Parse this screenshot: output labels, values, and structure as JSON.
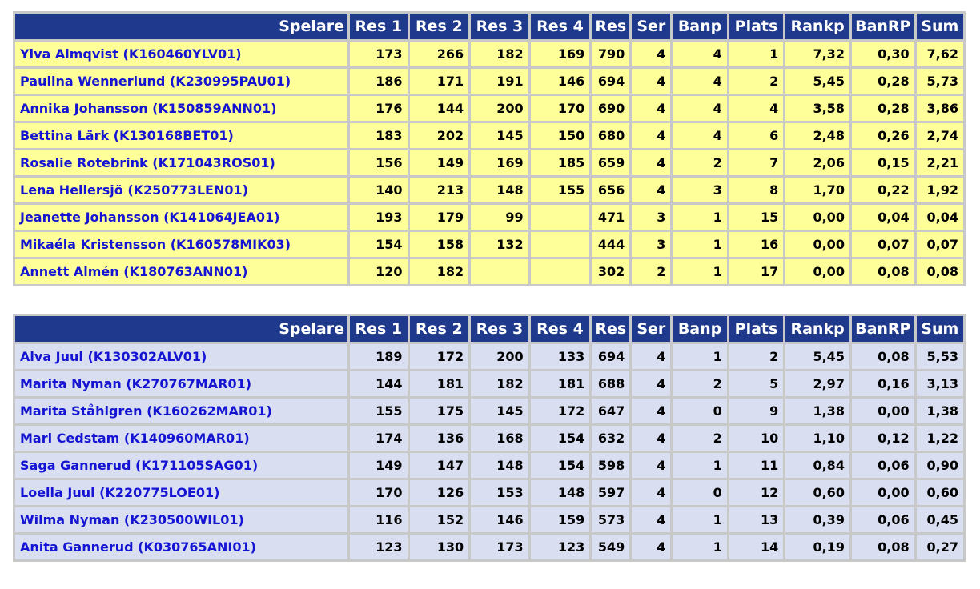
{
  "columns": [
    "Spelare",
    "Res 1",
    "Res 2",
    "Res 3",
    "Res 4",
    "Res",
    "Ser",
    "Banp",
    "Plats",
    "Rankp",
    "BanRP",
    "Sum"
  ],
  "tables": [
    {
      "rows": [
        {
          "name": "Ylva Almqvist (K160460YLV01)",
          "r1": "173",
          "r2": "266",
          "r3": "182",
          "r4": "169",
          "res": "790",
          "ser": "4",
          "banp": "4",
          "plats": "1",
          "rankp": "7,32",
          "banrp": "0,30",
          "sum": "7,62"
        },
        {
          "name": "Paulina Wennerlund (K230995PAU01)",
          "r1": "186",
          "r2": "171",
          "r3": "191",
          "r4": "146",
          "res": "694",
          "ser": "4",
          "banp": "4",
          "plats": "2",
          "rankp": "5,45",
          "banrp": "0,28",
          "sum": "5,73"
        },
        {
          "name": "Annika Johansson (K150859ANN01)",
          "r1": "176",
          "r2": "144",
          "r3": "200",
          "r4": "170",
          "res": "690",
          "ser": "4",
          "banp": "4",
          "plats": "4",
          "rankp": "3,58",
          "banrp": "0,28",
          "sum": "3,86"
        },
        {
          "name": "Bettina Lärk (K130168BET01)",
          "r1": "183",
          "r2": "202",
          "r3": "145",
          "r4": "150",
          "res": "680",
          "ser": "4",
          "banp": "4",
          "plats": "6",
          "rankp": "2,48",
          "banrp": "0,26",
          "sum": "2,74"
        },
        {
          "name": "Rosalie Rotebrink (K171043ROS01)",
          "r1": "156",
          "r2": "149",
          "r3": "169",
          "r4": "185",
          "res": "659",
          "ser": "4",
          "banp": "2",
          "plats": "7",
          "rankp": "2,06",
          "banrp": "0,15",
          "sum": "2,21"
        },
        {
          "name": "Lena Hellersjö (K250773LEN01)",
          "r1": "140",
          "r2": "213",
          "r3": "148",
          "r4": "155",
          "res": "656",
          "ser": "4",
          "banp": "3",
          "plats": "8",
          "rankp": "1,70",
          "banrp": "0,22",
          "sum": "1,92"
        },
        {
          "name": "Jeanette Johansson (K141064JEA01)",
          "r1": "193",
          "r2": "179",
          "r3": "99",
          "r4": "",
          "res": "471",
          "ser": "3",
          "banp": "1",
          "plats": "15",
          "rankp": "0,00",
          "banrp": "0,04",
          "sum": "0,04"
        },
        {
          "name": "Mikaéla Kristensson (K160578MIK03)",
          "r1": "154",
          "r2": "158",
          "r3": "132",
          "r4": "",
          "res": "444",
          "ser": "3",
          "banp": "1",
          "plats": "16",
          "rankp": "0,00",
          "banrp": "0,07",
          "sum": "0,07"
        },
        {
          "name": "Annett Almén (K180763ANN01)",
          "r1": "120",
          "r2": "182",
          "r3": "",
          "r4": "",
          "res": "302",
          "ser": "2",
          "banp": "1",
          "plats": "17",
          "rankp": "0,00",
          "banrp": "0,08",
          "sum": "0,08"
        }
      ]
    },
    {
      "rows": [
        {
          "name": "Alva Juul (K130302ALV01)",
          "r1": "189",
          "r2": "172",
          "r3": "200",
          "r4": "133",
          "res": "694",
          "ser": "4",
          "banp": "1",
          "plats": "2",
          "rankp": "5,45",
          "banrp": "0,08",
          "sum": "5,53"
        },
        {
          "name": "Marita Nyman (K270767MAR01)",
          "r1": "144",
          "r2": "181",
          "r3": "182",
          "r4": "181",
          "res": "688",
          "ser": "4",
          "banp": "2",
          "plats": "5",
          "rankp": "2,97",
          "banrp": "0,16",
          "sum": "3,13"
        },
        {
          "name": "Marita Ståhlgren (K160262MAR01)",
          "r1": "155",
          "r2": "175",
          "r3": "145",
          "r4": "172",
          "res": "647",
          "ser": "4",
          "banp": "0",
          "plats": "9",
          "rankp": "1,38",
          "banrp": "0,00",
          "sum": "1,38"
        },
        {
          "name": "Mari Cedstam (K140960MAR01)",
          "r1": "174",
          "r2": "136",
          "r3": "168",
          "r4": "154",
          "res": "632",
          "ser": "4",
          "banp": "2",
          "plats": "10",
          "rankp": "1,10",
          "banrp": "0,12",
          "sum": "1,22"
        },
        {
          "name": "Saga Gannerud (K171105SAG01)",
          "r1": "149",
          "r2": "147",
          "r3": "148",
          "r4": "154",
          "res": "598",
          "ser": "4",
          "banp": "1",
          "plats": "11",
          "rankp": "0,84",
          "banrp": "0,06",
          "sum": "0,90"
        },
        {
          "name": "Loella Juul (K220775LOE01)",
          "r1": "170",
          "r2": "126",
          "r3": "153",
          "r4": "148",
          "res": "597",
          "ser": "4",
          "banp": "0",
          "plats": "12",
          "rankp": "0,60",
          "banrp": "0,00",
          "sum": "0,60"
        },
        {
          "name": "Wilma Nyman (K230500WIL01)",
          "r1": "116",
          "r2": "152",
          "r3": "146",
          "r4": "159",
          "res": "573",
          "ser": "4",
          "banp": "1",
          "plats": "13",
          "rankp": "0,39",
          "banrp": "0,06",
          "sum": "0,45"
        },
        {
          "name": "Anita Gannerud (K030765ANI01)",
          "r1": "123",
          "r2": "130",
          "r3": "173",
          "r4": "123",
          "res": "549",
          "ser": "4",
          "banp": "1",
          "plats": "14",
          "rankp": "0,19",
          "banrp": "0,08",
          "sum": "0,27"
        }
      ]
    }
  ]
}
